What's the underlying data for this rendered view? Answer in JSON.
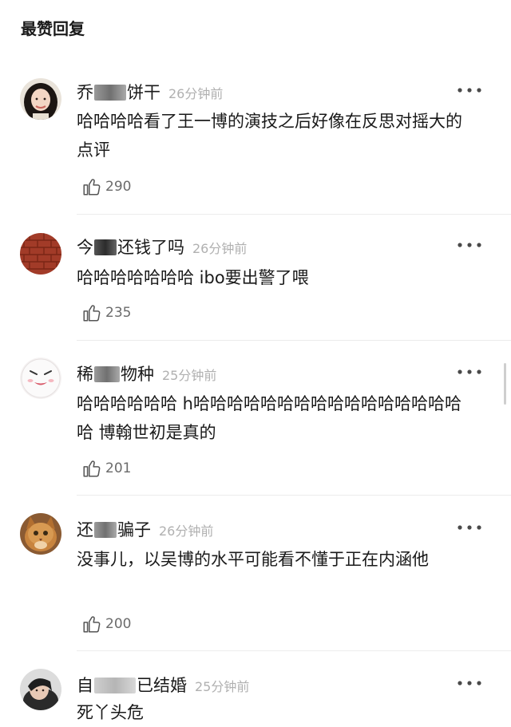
{
  "section": {
    "title": "最赞回复"
  },
  "comments": [
    {
      "name_prefix": "乔",
      "name_suffix": "饼干",
      "time": "26分钟前",
      "text": "哈哈哈哈看了王一博的演技之后好像在反思对摇大的点评",
      "likes": "290"
    },
    {
      "name_prefix": "今",
      "name_suffix": "还钱了吗",
      "time": "26分钟前",
      "text": "哈哈哈哈哈哈哈 ibo要出警了喂",
      "likes": "235"
    },
    {
      "name_prefix": "稀",
      "name_suffix": "物种",
      "time": "25分钟前",
      "text": "哈哈哈哈哈哈 h哈哈哈哈哈哈哈哈哈哈哈哈哈哈哈哈哈 博翰世初是真的",
      "likes": "201"
    },
    {
      "name_prefix": "还",
      "name_suffix": "骗子",
      "time": "26分钟前",
      "text": "没事儿，以吴博的水平可能看不懂于正在内涵他",
      "likes": "200"
    },
    {
      "name_prefix": "自",
      "name_suffix": "已结婚",
      "time": "25分钟前",
      "text": "死丫头危",
      "likes": ""
    }
  ],
  "icons": {
    "more": "more-dots-icon",
    "like": "thumbs-up-icon"
  },
  "colors": {
    "text": "#1a1a1a",
    "muted": "#b0b0b0",
    "like_count": "#6b6b6b",
    "divider": "#ececec"
  }
}
